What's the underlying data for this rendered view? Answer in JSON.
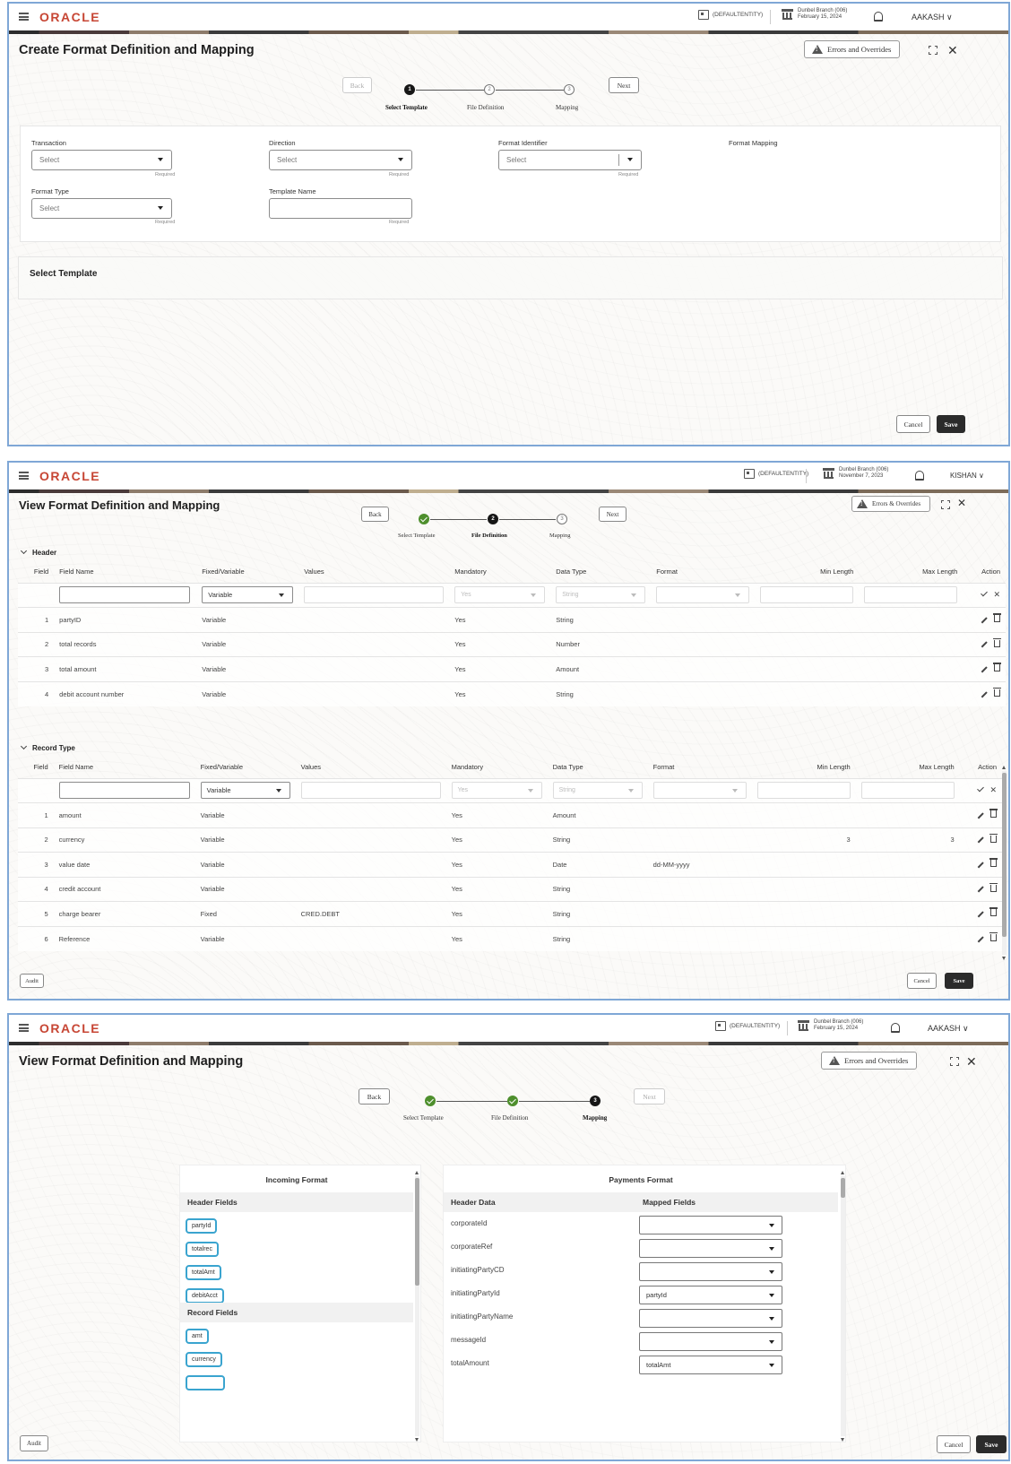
{
  "common": {
    "logo": "ORACLE",
    "entity": "(DEFAULTENTITY)",
    "save": "Save",
    "cancel": "Cancel",
    "audit": "Audit",
    "back": "Back",
    "next": "Next",
    "required": "Required",
    "select_placeholder": "Select"
  },
  "screen1": {
    "title": "Create Format Definition and Mapping",
    "errors_button": "Errors and Overrides",
    "branch_line1": "Dunbel Branch (006)",
    "branch_line2": "February 15, 2024",
    "user": "AAKASH",
    "steps": [
      {
        "num": "1",
        "label": "Select Template",
        "state": "current"
      },
      {
        "num": "2",
        "label": "File Definition",
        "state": "future"
      },
      {
        "num": "3",
        "label": "Mapping",
        "state": "future"
      }
    ],
    "fields": {
      "transaction": "Transaction",
      "direction": "Direction",
      "format_identifier": "Format Identifier",
      "format_mapping": "Format Mapping",
      "format_type": "Format Type",
      "template_name": "Template Name"
    },
    "section_title": "Select Template"
  },
  "screen2": {
    "title": "View Format Definition and Mapping",
    "errors_button": "Errors & Overrides",
    "branch_line1": "Dunbel Branch (006)",
    "branch_line2": "November 7, 2023",
    "user": "KISHAN",
    "steps": [
      {
        "num": "",
        "label": "Select Template",
        "state": "done"
      },
      {
        "num": "2",
        "label": "File Definition",
        "state": "current"
      },
      {
        "num": "3",
        "label": "Mapping",
        "state": "future"
      }
    ],
    "columns": [
      "Field",
      "Field Name",
      "Fixed/Variable",
      "Values",
      "Mandatory",
      "Data Type",
      "Format",
      "Min Length",
      "Max Length",
      "Action"
    ],
    "new_row": {
      "fixed_variable": "Variable",
      "mandatory": "Yes",
      "data_type": "String"
    },
    "header_section": {
      "title": "Header",
      "rows": [
        {
          "field": "1",
          "name": "partyID",
          "fv": "Variable",
          "values": "",
          "mandatory": "Yes",
          "type": "String",
          "format": "",
          "min": "",
          "max": ""
        },
        {
          "field": "2",
          "name": "total records",
          "fv": "Variable",
          "values": "",
          "mandatory": "Yes",
          "type": "Number",
          "format": "",
          "min": "",
          "max": ""
        },
        {
          "field": "3",
          "name": "total amount",
          "fv": "Variable",
          "values": "",
          "mandatory": "Yes",
          "type": "Amount",
          "format": "",
          "min": "",
          "max": ""
        },
        {
          "field": "4",
          "name": "debit account number",
          "fv": "Variable",
          "values": "",
          "mandatory": "Yes",
          "type": "String",
          "format": "",
          "min": "",
          "max": ""
        }
      ]
    },
    "record_section": {
      "title": "Record Type",
      "rows": [
        {
          "field": "1",
          "name": "amount",
          "fv": "Variable",
          "values": "",
          "mandatory": "Yes",
          "type": "Amount",
          "format": "",
          "min": "",
          "max": ""
        },
        {
          "field": "2",
          "name": "currency",
          "fv": "Variable",
          "values": "",
          "mandatory": "Yes",
          "type": "String",
          "format": "",
          "min": "3",
          "max": "3"
        },
        {
          "field": "3",
          "name": "value date",
          "fv": "Variable",
          "values": "",
          "mandatory": "Yes",
          "type": "Date",
          "format": "dd-MM-yyyy",
          "min": "",
          "max": ""
        },
        {
          "field": "4",
          "name": "credit account",
          "fv": "Variable",
          "values": "",
          "mandatory": "Yes",
          "type": "String",
          "format": "",
          "min": "",
          "max": ""
        },
        {
          "field": "5",
          "name": "charge bearer",
          "fv": "Fixed",
          "values": "CRED.DEBT",
          "mandatory": "Yes",
          "type": "String",
          "format": "",
          "min": "",
          "max": ""
        },
        {
          "field": "6",
          "name": "Reference",
          "fv": "Variable",
          "values": "",
          "mandatory": "Yes",
          "type": "String",
          "format": "",
          "min": "",
          "max": ""
        }
      ]
    }
  },
  "screen3": {
    "title": "View Format Definition and Mapping",
    "errors_button": "Errors and Overrides",
    "branch_line1": "Dunbel Branch (006)",
    "branch_line2": "February 15, 2024",
    "user": "AAKASH",
    "steps": [
      {
        "num": "",
        "label": "Select Template",
        "state": "done"
      },
      {
        "num": "",
        "label": "File Definition",
        "state": "done"
      },
      {
        "num": "3",
        "label": "Mapping",
        "state": "current"
      }
    ],
    "incoming": {
      "title": "Incoming Format",
      "header_fields_label": "Header Fields",
      "header_fields": [
        "partyId",
        "totalrec",
        "totalAmt",
        "debitAcct"
      ],
      "record_fields_label": "Record Fields",
      "record_fields": [
        "amt",
        "currency",
        ""
      ]
    },
    "payments": {
      "title": "Payments Format",
      "col_header_data": "Header Data",
      "col_mapped": "Mapped Fields",
      "rows": [
        {
          "label": "corporateId",
          "mapped": ""
        },
        {
          "label": "corporateRef",
          "mapped": ""
        },
        {
          "label": "initiatingPartyCD",
          "mapped": ""
        },
        {
          "label": "initiatingPartyId",
          "mapped": "partyId"
        },
        {
          "label": "initiatingPartyName",
          "mapped": ""
        },
        {
          "label": "messageId",
          "mapped": ""
        },
        {
          "label": "totalAmount",
          "mapped": "totalAmt"
        }
      ]
    }
  }
}
